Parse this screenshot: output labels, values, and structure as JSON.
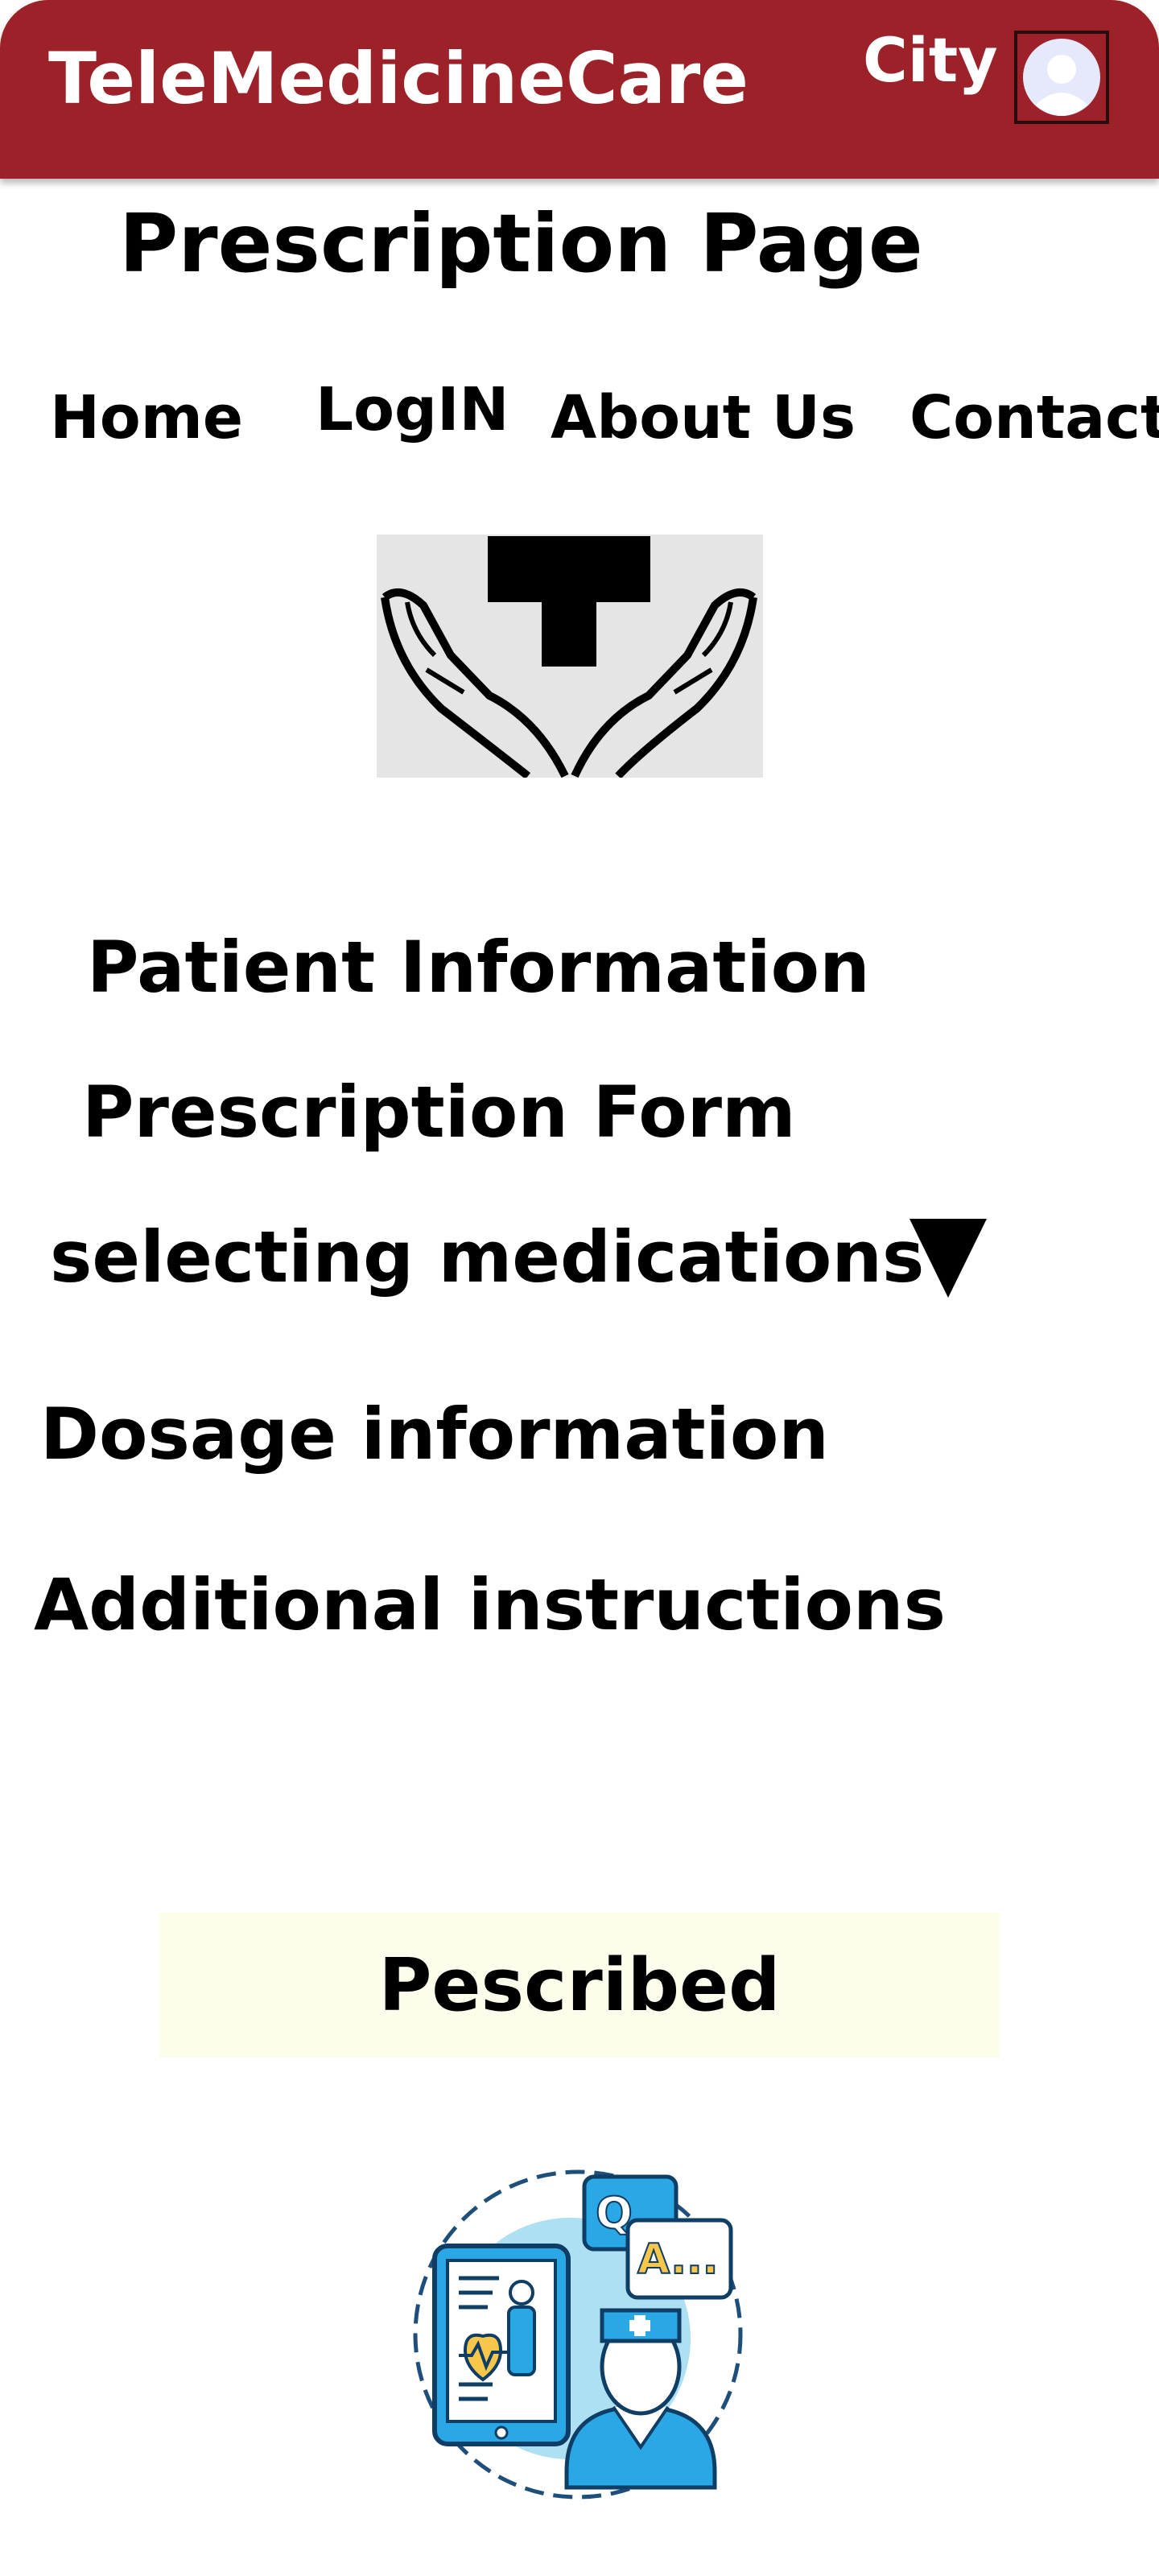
{
  "header": {
    "brand": "TeleMedicineCare",
    "city": "City",
    "colors": {
      "bar": "#9c2128",
      "text": "#ffffff"
    }
  },
  "page": {
    "title": "Prescription Page"
  },
  "nav": {
    "items": [
      {
        "label": "Home"
      },
      {
        "label": "LogIN"
      },
      {
        "label": "About Us"
      },
      {
        "label": "Contact"
      }
    ]
  },
  "logo": {
    "icon": "hands-medical-cross-icon"
  },
  "sections": {
    "patient_info": "Patient Information",
    "prescription_form": "Prescription Form",
    "selecting_medications": "selecting medications",
    "dosage": "Dosage information",
    "additional": "Additional instructions"
  },
  "prescribed": {
    "label": "Pescribed",
    "background": "#fdfdeb"
  },
  "illustration": {
    "icon": "telemedicine-doctor-icon"
  }
}
